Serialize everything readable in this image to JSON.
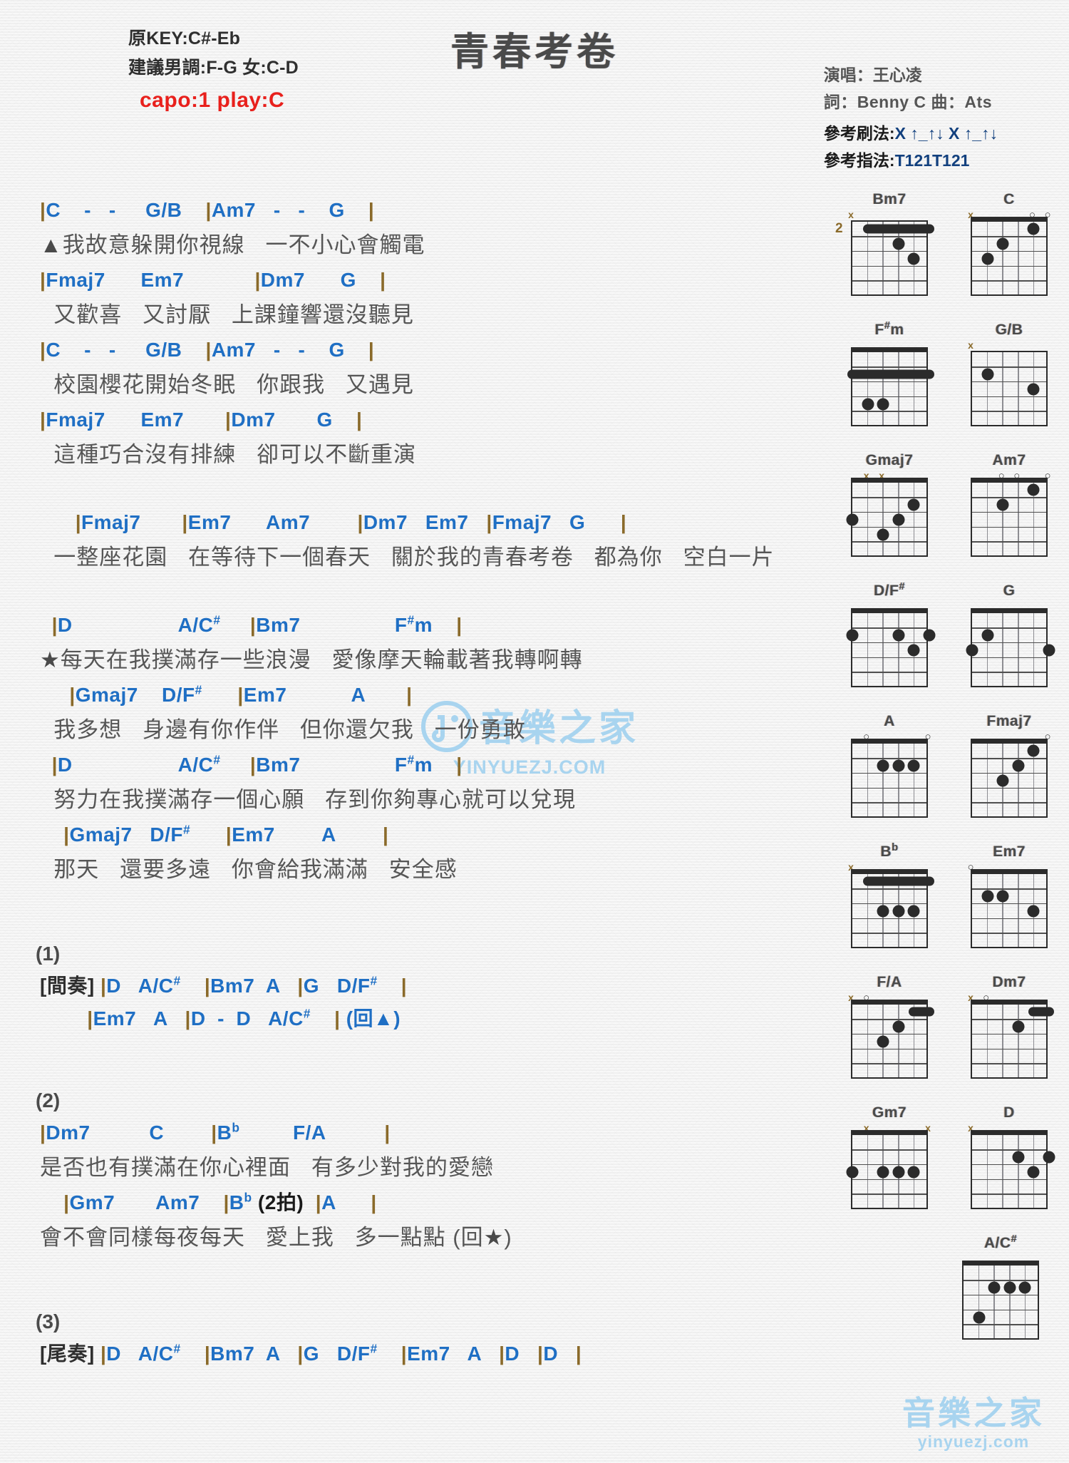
{
  "header": {
    "original_key": "原KEY:C#-Eb",
    "suggested_key": "建議男調:F-G 女:C-D",
    "capo": "capo:1 play:C",
    "title": "青春考卷",
    "singer": "演唱：王心凌",
    "writers": "詞：Benny C   曲：Ats",
    "strum_label": "參考刷法:",
    "strum_value": "X ↑_↑↓ X ↑_↑↓",
    "fingering_label": "參考指法:",
    "fingering_value": "T121T121",
    "accent_color": "#e8201c",
    "chord_color": "#1f6fc4"
  },
  "sections": [
    {
      "id": "verse1",
      "lines": [
        {
          "type": "chord",
          "text": "|C    -   -     G/B    |Am7   -   -    G    |"
        },
        {
          "type": "lyric",
          "text": "▲我故意躲開你視線   一不小心會觸電"
        },
        {
          "type": "chord",
          "text": "|Fmaj7      Em7            |Dm7      G    |"
        },
        {
          "type": "lyric",
          "text": "  又歡喜   又討厭   上課鐘響還沒聽見"
        },
        {
          "type": "chord",
          "text": "|C    -   -     G/B    |Am7   -   -    G    |"
        },
        {
          "type": "lyric",
          "text": "  校園櫻花開始冬眠   你跟我   又遇見"
        },
        {
          "type": "chord",
          "text": "|Fmaj7      Em7       |Dm7       G    |"
        },
        {
          "type": "lyric",
          "text": "  這種巧合沒有排練   卻可以不斷重演"
        }
      ]
    },
    {
      "id": "prechorus",
      "lines": [
        {
          "type": "chord",
          "text": "      |Fmaj7       |Em7      Am7        |Dm7   Em7   |Fmaj7   G      |"
        },
        {
          "type": "lyric",
          "text": "  一整座花園   在等待下一個春天   關於我的青春考卷   都為你   空白一片"
        }
      ]
    },
    {
      "id": "chorus",
      "lines": [
        {
          "type": "chord",
          "text": "  |D                  A/C#     |Bm7                F#m    |"
        },
        {
          "type": "lyric",
          "text": "★每天在我撲滿存一些浪漫   愛像摩天輪載著我轉啊轉"
        },
        {
          "type": "chord",
          "text": "     |Gmaj7    D/F#      |Em7           A       |"
        },
        {
          "type": "lyric",
          "text": "  我多想   身邊有你作伴   但你還欠我   一份勇敢"
        },
        {
          "type": "chord",
          "text": "  |D                  A/C#     |Bm7                F#m    |"
        },
        {
          "type": "lyric",
          "text": "  努力在我撲滿存一個心願   存到你夠專心就可以兌現"
        },
        {
          "type": "chord",
          "text": "    |Gmaj7   D/F#      |Em7        A        |"
        },
        {
          "type": "lyric",
          "text": "  那天   還要多遠   你會給我滿滿   安全感"
        }
      ]
    },
    {
      "id": "part1",
      "number": "(1)",
      "lines": [
        {
          "type": "chord",
          "text": "[間奏] |D   A/C#    |Bm7  A   |G   D/F#    |",
          "label": "[間奏]"
        },
        {
          "type": "chord",
          "text": "        |Em7   A   |D  -  D   A/C#    | (回▲)"
        }
      ]
    },
    {
      "id": "part2",
      "number": "(2)",
      "lines": [
        {
          "type": "chord",
          "text": "|Dm7          C        |Bb         F/A          |"
        },
        {
          "type": "lyric",
          "text": "是否也有撲滿在你心裡面   有多少對我的愛戀"
        },
        {
          "type": "chord",
          "text": "    |Gm7       Am7    |Bb (2拍)  |A      |"
        },
        {
          "type": "lyric",
          "text": "會不會同樣每夜每天   愛上我   多一點點 (回★)"
        }
      ]
    },
    {
      "id": "part3",
      "number": "(3)",
      "lines": [
        {
          "type": "chord",
          "text": "[尾奏] |D   A/C#    |Bm7  A   |G   D/F#    |Em7   A   |D   |D   |",
          "label": "[尾奏]"
        }
      ]
    }
  ],
  "chord_diagrams": [
    {
      "name": "Bm7",
      "position": "2",
      "nut": false,
      "marks": [
        {
          "s": 6,
          "t": "x"
        }
      ],
      "barre": {
        "fret": 1,
        "from": 5,
        "to": 1
      },
      "dots": [
        {
          "s": 3,
          "f": 2
        },
        {
          "s": 2,
          "f": 3
        }
      ]
    },
    {
      "name": "C",
      "position": "",
      "nut": true,
      "marks": [
        {
          "s": 6,
          "t": "x"
        },
        {
          "s": 2,
          "t": "o"
        },
        {
          "s": 1,
          "t": "o"
        }
      ],
      "barre": null,
      "dots": [
        {
          "s": 5,
          "f": 3
        },
        {
          "s": 4,
          "f": 2
        },
        {
          "s": 2,
          "f": 1
        }
      ]
    },
    {
      "name": "F#m",
      "position": "",
      "nut": true,
      "marks": [],
      "barre": {
        "fret": 2,
        "from": 6,
        "to": 1
      },
      "dots": [
        {
          "s": 5,
          "f": 4
        },
        {
          "s": 4,
          "f": 4
        }
      ]
    },
    {
      "name": "G/B",
      "position": "",
      "nut": false,
      "marks": [
        {
          "s": 6,
          "t": "x"
        }
      ],
      "barre": null,
      "dots": [
        {
          "s": 5,
          "f": 2
        },
        {
          "s": 2,
          "f": 3
        }
      ]
    },
    {
      "name": "Gmaj7",
      "position": "",
      "nut": true,
      "marks": [
        {
          "s": 5,
          "t": "x"
        },
        {
          "s": 4,
          "t": "x"
        }
      ],
      "barre": null,
      "dots": [
        {
          "s": 6,
          "f": 3
        },
        {
          "s": 3,
          "f": 3
        },
        {
          "s": 2,
          "f": 2
        },
        {
          "s": 4,
          "f": 4
        }
      ]
    },
    {
      "name": "Am7",
      "position": "",
      "nut": true,
      "marks": [
        {
          "s": 4,
          "t": "o"
        },
        {
          "s": 3,
          "t": "o"
        },
        {
          "s": 1,
          "t": "o"
        }
      ],
      "barre": null,
      "dots": [
        {
          "s": 4,
          "f": 2
        },
        {
          "s": 2,
          "f": 1
        }
      ]
    },
    {
      "name": "D/F#",
      "position": "",
      "nut": true,
      "marks": [],
      "barre": null,
      "dots": [
        {
          "s": 6,
          "f": 2
        },
        {
          "s": 3,
          "f": 2
        },
        {
          "s": 1,
          "f": 2
        },
        {
          "s": 2,
          "f": 3
        }
      ]
    },
    {
      "name": "G",
      "position": "",
      "nut": true,
      "marks": [],
      "barre": null,
      "dots": [
        {
          "s": 5,
          "f": 2
        },
        {
          "s": 6,
          "f": 3
        },
        {
          "s": 1,
          "f": 3
        }
      ]
    },
    {
      "name": "A",
      "position": "",
      "nut": true,
      "marks": [
        {
          "s": 5,
          "t": "o"
        },
        {
          "s": 1,
          "t": "o"
        }
      ],
      "barre": null,
      "dots": [
        {
          "s": 4,
          "f": 2
        },
        {
          "s": 3,
          "f": 2
        },
        {
          "s": 2,
          "f": 2
        }
      ]
    },
    {
      "name": "Fmaj7",
      "position": "",
      "nut": true,
      "marks": [
        {
          "s": 1,
          "t": "o"
        }
      ],
      "barre": null,
      "dots": [
        {
          "s": 2,
          "f": 1
        },
        {
          "s": 3,
          "f": 2
        },
        {
          "s": 4,
          "f": 3
        }
      ]
    },
    {
      "name": "Bb",
      "position": "",
      "nut": true,
      "marks": [
        {
          "s": 6,
          "t": "x"
        }
      ],
      "barre": {
        "fret": 1,
        "from": 5,
        "to": 1
      },
      "dots": [
        {
          "s": 4,
          "f": 3
        },
        {
          "s": 3,
          "f": 3
        },
        {
          "s": 2,
          "f": 3
        }
      ]
    },
    {
      "name": "Em7",
      "position": "",
      "nut": true,
      "marks": [
        {
          "s": 6,
          "t": "o"
        }
      ],
      "barre": null,
      "dots": [
        {
          "s": 5,
          "f": 2
        },
        {
          "s": 4,
          "f": 2
        },
        {
          "s": 2,
          "f": 3
        }
      ]
    },
    {
      "name": "F/A",
      "position": "",
      "nut": true,
      "marks": [
        {
          "s": 6,
          "t": "x"
        },
        {
          "s": 5,
          "t": "o"
        }
      ],
      "barre": {
        "fret": 1,
        "from": 2,
        "to": 1
      },
      "dots": [
        {
          "s": 3,
          "f": 2
        },
        {
          "s": 4,
          "f": 3
        }
      ]
    },
    {
      "name": "Dm7",
      "position": "",
      "nut": true,
      "marks": [
        {
          "s": 6,
          "t": "x"
        },
        {
          "s": 5,
          "t": "o"
        }
      ],
      "barre": {
        "fret": 1,
        "from": 2,
        "to": 1
      },
      "dots": [
        {
          "s": 3,
          "f": 2
        }
      ]
    },
    {
      "name": "Gm7",
      "position": "",
      "nut": true,
      "marks": [
        {
          "s": 5,
          "t": "x"
        },
        {
          "s": 1,
          "t": "x"
        }
      ],
      "barre": null,
      "dots": [
        {
          "s": 6,
          "f": 3
        },
        {
          "s": 4,
          "f": 3
        },
        {
          "s": 3,
          "f": 3
        },
        {
          "s": 2,
          "f": 3
        }
      ]
    },
    {
      "name": "D",
      "position": "",
      "nut": true,
      "marks": [
        {
          "s": 6,
          "t": "x"
        }
      ],
      "barre": null,
      "dots": [
        {
          "s": 3,
          "f": 2
        },
        {
          "s": 1,
          "f": 2
        },
        {
          "s": 2,
          "f": 3
        }
      ]
    },
    {
      "name": "A/C#",
      "position": "",
      "nut": true,
      "marks": [],
      "barre": null,
      "dots": [
        {
          "s": 4,
          "f": 2
        },
        {
          "s": 3,
          "f": 2
        },
        {
          "s": 2,
          "f": 2
        },
        {
          "s": 5,
          "f": 4
        }
      ]
    }
  ],
  "watermarks": {
    "main_text": "音樂之家",
    "main_sub": "YINYUEZJ.COM",
    "corner_text": "音樂之家",
    "corner_sub": "yinyuezj.com",
    "color": "#a8d4ef"
  }
}
